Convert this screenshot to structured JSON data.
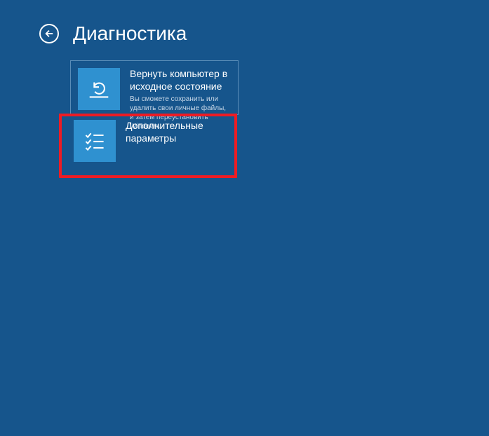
{
  "header": {
    "title": "Диагностика"
  },
  "options": [
    {
      "title": "Вернуть компьютер в исходное состояние",
      "description": "Вы сможете сохранить или удалить свои личные файлы, и затем переустановить Windows.",
      "icon": "reset",
      "selected": true,
      "highlighted": false
    },
    {
      "title": "Дополнительные параметры",
      "description": "",
      "icon": "checklist",
      "selected": false,
      "highlighted": true
    }
  ]
}
